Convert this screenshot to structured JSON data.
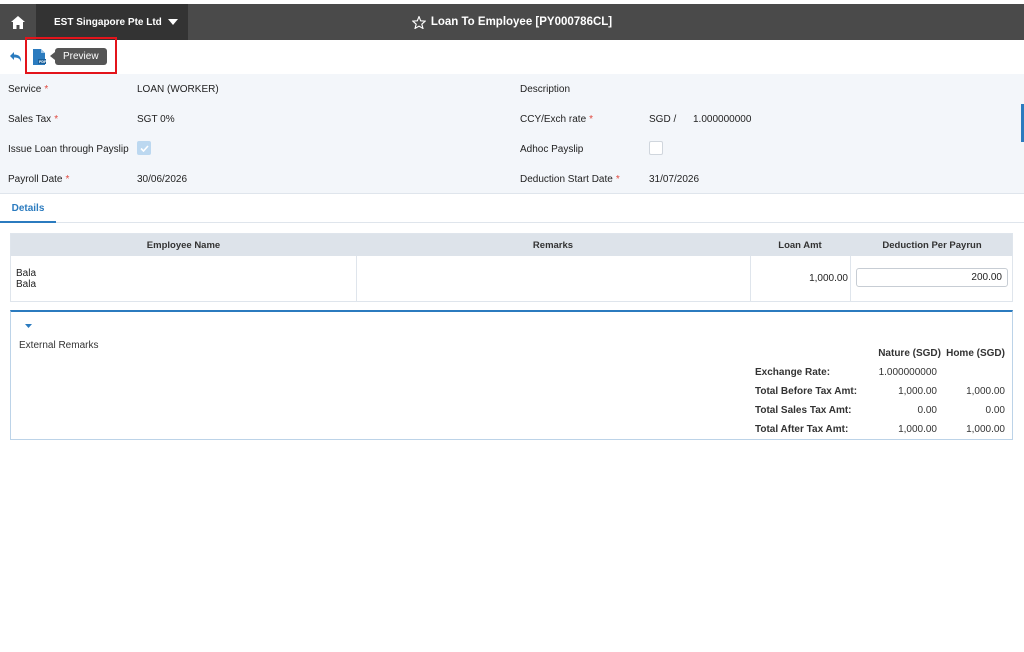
{
  "header": {
    "company": "EST Singapore Pte Ltd",
    "title": "Loan To Employee [PY000786CL]"
  },
  "toolbar": {
    "tooltip": "Preview"
  },
  "form": {
    "service_label": "Service",
    "service_value": "LOAN (WORKER)",
    "description_label": "Description",
    "sales_tax_label": "Sales Tax",
    "sales_tax_value": "SGT 0%",
    "ccy_label": "CCY/Exch rate",
    "ccy_value": "SGD /",
    "exch_rate_value": "1.000000000",
    "issue_loan_label": "Issue Loan through Payslip",
    "issue_loan_checked": true,
    "adhoc_label": "Adhoc Payslip",
    "adhoc_checked": false,
    "payroll_date_label": "Payroll Date",
    "payroll_date_value": "30/06/2026",
    "deduction_start_label": "Deduction Start Date",
    "deduction_start_value": "31/07/2026",
    "required_mark": "*"
  },
  "tabs": [
    {
      "label": "Details"
    }
  ],
  "grid": {
    "headers": [
      "Employee Name",
      "Remarks",
      "Loan Amt",
      "Deduction Per Payrun"
    ],
    "rows": [
      {
        "name": "Bala",
        "name_sub": "Bala",
        "remarks": "",
        "loan_amt": "1,000.00",
        "deduction": "200.00"
      }
    ]
  },
  "summary": {
    "external_remarks_label": "External Remarks",
    "col_nature": "Nature (SGD)",
    "col_home": "Home (SGD)",
    "rows": [
      {
        "label": "Exchange Rate:",
        "nature": "1.000000000",
        "home": ""
      },
      {
        "label": "Total Before Tax Amt:",
        "nature": "1,000.00",
        "home": "1,000.00"
      },
      {
        "label": "Total Sales Tax Amt:",
        "nature": "0.00",
        "home": "0.00"
      },
      {
        "label": "Total After Tax Amt:",
        "nature": "1,000.00",
        "home": "1,000.00"
      }
    ]
  },
  "colors": {
    "topbar": "#4a4a4a",
    "accent": "#2b7bbf",
    "highlight": "#e3141b"
  }
}
